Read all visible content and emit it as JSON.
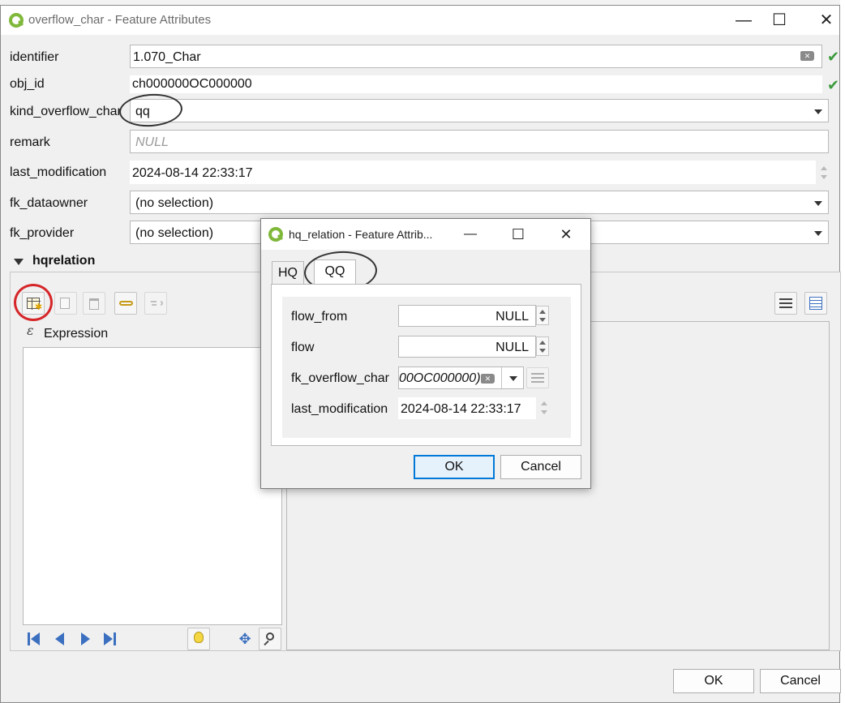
{
  "main_window": {
    "title": "overflow_char - Feature Attributes",
    "controls": {
      "minimize": "—",
      "maximize": "☐",
      "close": "✕"
    },
    "fields": {
      "identifier": {
        "label": "identifier",
        "value": "1.070_Char"
      },
      "obj_id": {
        "label": "obj_id",
        "value": "ch000000OC000000"
      },
      "kind_overflow_char": {
        "label": "kind_overflow_char",
        "value": "qq"
      },
      "remark": {
        "label": "remark",
        "placeholder": "NULL"
      },
      "last_modification": {
        "label": "last_modification",
        "value": "2024-08-14 22:33:17"
      },
      "fk_dataowner": {
        "label": "fk_dataowner",
        "value": "(no selection)"
      },
      "fk_provider": {
        "label": "fk_provider",
        "value": "(no selection)"
      }
    },
    "section": {
      "title": "hqrelation",
      "expression_label": "Expression"
    },
    "buttons": {
      "ok": "OK",
      "cancel": "Cancel"
    }
  },
  "child_dialog": {
    "title": "hq_relation - Feature Attrib...",
    "tabs": [
      {
        "label": "HQ"
      },
      {
        "label": "QQ",
        "active": true
      }
    ],
    "fields": {
      "flow_from": {
        "label": "flow_from",
        "value": "NULL"
      },
      "flow": {
        "label": "flow",
        "value": "NULL"
      },
      "fk_overflow_char": {
        "label": "fk_overflow_char",
        "value": "00OC000000)"
      },
      "last_modification": {
        "label": "last_modification",
        "value": "2024-08-14 22:33:17"
      }
    },
    "buttons": {
      "ok": "OK",
      "cancel": "Cancel"
    }
  },
  "colors": {
    "accent": "#0078d7",
    "check": "#3c9a3c",
    "qgis_green": "#7fb83a",
    "annotation_red": "#d6262a",
    "nav_blue": "#3b6fbf"
  }
}
